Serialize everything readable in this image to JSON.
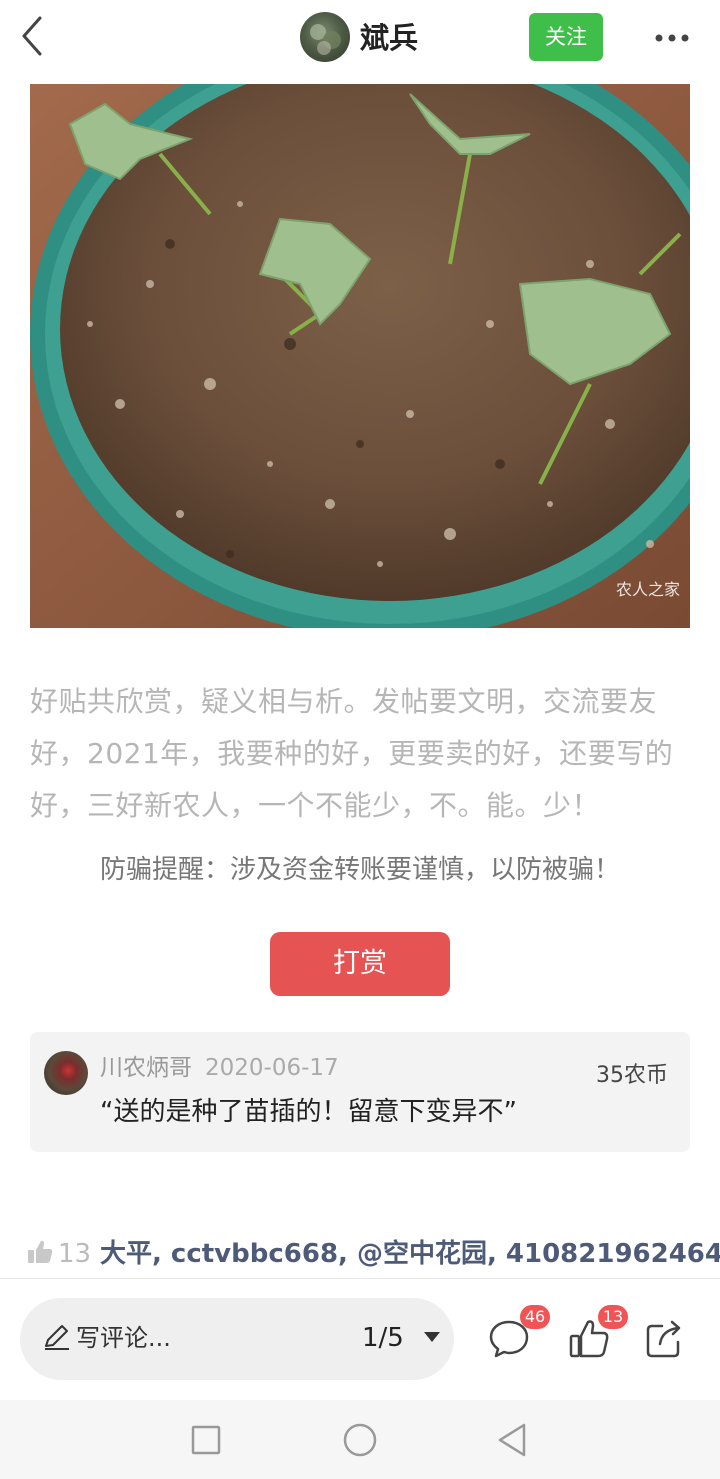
{
  "header": {
    "username": "斌兵",
    "follow_label": "关注"
  },
  "photo": {
    "watermark": "农人之家"
  },
  "post": {
    "text": "好贴共欣赏，疑义相与析。发帖要文明，交流要友好，2021年，我要种的好，更要卖的好，还要写的好，三好新农人，一个不能少，不。能。少！",
    "warning": "防骗提醒：涉及资金转账要谨慎，以防被骗！",
    "reward_label": "打赏"
  },
  "reward_record": {
    "name": "川农炳哥",
    "date": "2020-06-17",
    "amount": "35农币",
    "quote": "“送的是种了苗插的！留意下变异不”"
  },
  "likes": {
    "count": "13",
    "names": "大平, cctvbbc668, @空中花园, 410821962464,"
  },
  "bottom_bar": {
    "comment_placeholder": "写评论...",
    "page_indicator": "1/5",
    "comment_badge": "46",
    "like_badge": "13"
  },
  "colors": {
    "follow_green": "#3fbf4a",
    "reward_red": "#e55353",
    "badge_red": "#f05454",
    "liker_blue": "#4e5b78"
  },
  "icons": [
    "back-arrow-icon",
    "more-dots-icon",
    "pencil-icon",
    "caret-down-icon",
    "comment-bubble-icon",
    "thumbs-up-icon",
    "share-icon",
    "nav-square-icon",
    "nav-circle-icon",
    "nav-triangle-icon"
  ]
}
